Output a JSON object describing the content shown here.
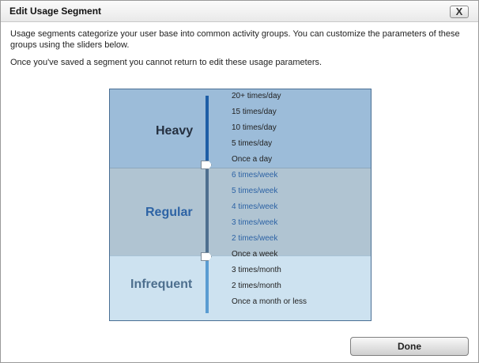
{
  "dialog": {
    "title": "Edit Usage Segment",
    "close_label": "X",
    "description": "Usage segments categorize your user base into common activity groups. You can customize the parameters of these groups using the sliders below.",
    "warning": "Once you've saved a segment you cannot return to edit these usage parameters.",
    "done_label": "Done"
  },
  "segments": {
    "heavy": "Heavy",
    "regular": "Regular",
    "infrequent": "Infrequent"
  },
  "frequencies": [
    "20+ times/day",
    "15 times/day",
    "10 times/day",
    "5 times/day",
    "Once a day",
    "6 times/week",
    "5 times/week",
    "4 times/week",
    "3 times/week",
    "2 times/week",
    "Once a week",
    "3 times/month",
    "2 times/month",
    "Once a month or less"
  ],
  "colors": {
    "heavy_zone": "#9cbcd9",
    "regular_zone": "#b0c4d2",
    "infrequent_zone": "#cde2f0",
    "regular_text": "#2d63a5"
  }
}
